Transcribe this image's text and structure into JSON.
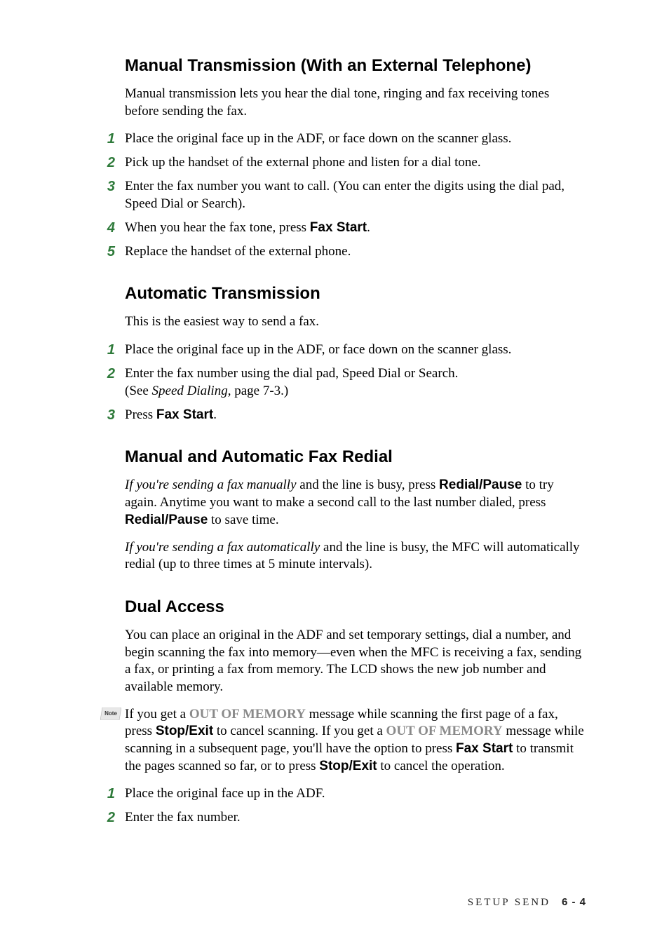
{
  "s1": {
    "heading": "Manual Transmission (With an External Telephone)",
    "intro": "Manual transmission lets you hear the dial tone, ringing and fax receiving tones before sending the fax.",
    "steps": {
      "1": "Place the original face up in the ADF, or face down on the scanner glass.",
      "2": "Pick up the handset of the external phone and listen for a dial tone.",
      "3": "Enter the fax number you want to call. (You can enter the digits using the dial pad, Speed Dial or Search).",
      "4_pre": "When you hear the fax tone, press ",
      "4_bold": "Fax Start",
      "4_post": ".",
      "5": "Replace the handset of the external phone."
    }
  },
  "s2": {
    "heading": "Automatic Transmission",
    "intro": "This is the easiest way to send a fax.",
    "steps": {
      "1": "Place the original face up in the ADF, or face down on the scanner glass.",
      "2_line1": "Enter the fax number using the dial pad, Speed Dial or Search.",
      "2_line2_pre": " (See ",
      "2_line2_it": "Speed Dialing",
      "2_line2_post": ", page 7-3.)",
      "3_pre": "Press ",
      "3_bold": "Fax Start",
      "3_post": "."
    }
  },
  "s3": {
    "heading": "Manual and Automatic Fax Redial",
    "p1_it": "If  you're sending a fax manually",
    "p1_mid": " and the line is busy, press ",
    "p1_b1": "Redial/Pause",
    "p1_mid2": " to try again. Anytime you want to make a second call to the last number dialed, press ",
    "p1_b2": "Redial/Pause",
    "p1_post": " to save time.",
    "p2_it": "If you're sending a fax automatically",
    "p2_post": " and the line is busy, the MFC will automatically redial (up to three times at 5 minute intervals)."
  },
  "s4": {
    "heading": "Dual Access",
    "p1": "You can place an original in the ADF and set temporary settings, dial a number, and begin scanning the fax into memory—even when the MFC is receiving a fax, sending a fax, or printing a fax from memory. The LCD shows the new job number and available memory.",
    "note_label": "Note",
    "note_a": "If you get a ",
    "note_oom1": "OUT OF MEMORY",
    "note_b": " message while scanning the first page of a fax, press ",
    "note_stop1": "Stop/Exit",
    "note_c": " to cancel scanning.  If you get a ",
    "note_oom2": "OUT OF MEMORY",
    "note_d": " message while scanning in a subsequent page, you'll have the option to press ",
    "note_fax": "Fax Start",
    "note_e": " to transmit the pages scanned so far, or to press ",
    "note_stop2": "Stop/Exit",
    "note_f": " to cancel the operation.",
    "steps": {
      "1": "Place the original face up in the ADF.",
      "2": "Enter the fax number."
    }
  },
  "footer": {
    "section": "SETUP SEND",
    "page": "6 - 4"
  }
}
